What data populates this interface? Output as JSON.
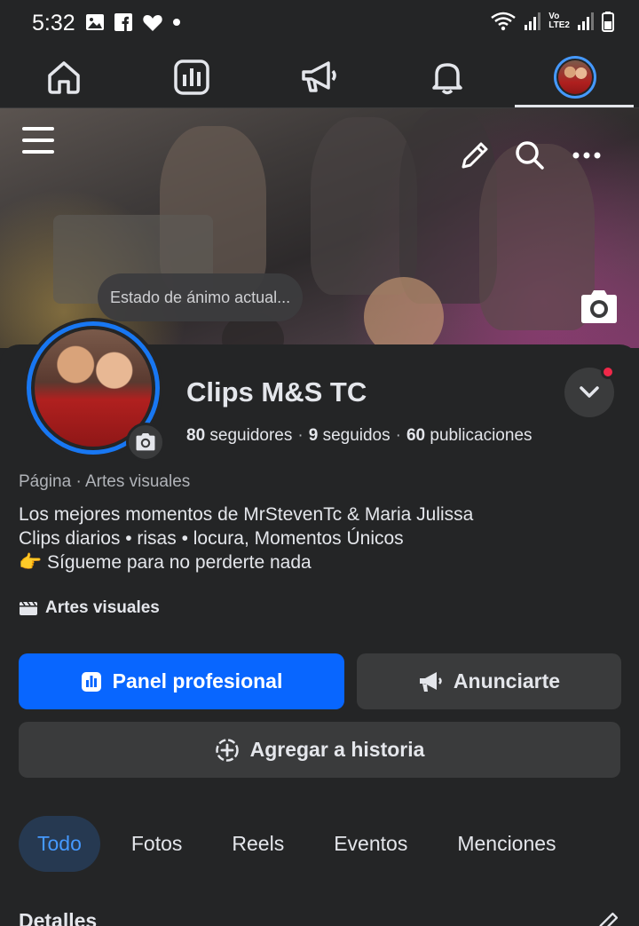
{
  "status_bar": {
    "time": "5:32",
    "left_icons": [
      "image-icon",
      "facebook-icon",
      "heart-icon",
      "dot-icon"
    ],
    "right_icons": [
      "wifi-icon",
      "signal-icon",
      "volte-icon",
      "signal-icon",
      "battery-icon"
    ],
    "volte_label_top": "Vo",
    "volte_label_bottom": "LTE2"
  },
  "top_nav": {
    "items": [
      {
        "name": "home",
        "icon": "home-icon"
      },
      {
        "name": "dashboard",
        "icon": "chart-icon"
      },
      {
        "name": "ads",
        "icon": "megaphone-icon"
      },
      {
        "name": "notifications",
        "icon": "bell-icon"
      },
      {
        "name": "profile",
        "icon": "avatar-icon"
      }
    ],
    "active": "profile"
  },
  "cover": {
    "mood_placeholder": "Estado de ánimo actual...",
    "icons": [
      "menu-icon",
      "pencil-icon",
      "search-icon",
      "more-icon",
      "camera-icon"
    ]
  },
  "profile": {
    "name": "Clips M&S TC",
    "followers_count": "80",
    "followers_label": "seguidores",
    "following_count": "9",
    "following_label": "seguidos",
    "posts_count": "60",
    "posts_label": "publicaciones",
    "separator": "·",
    "category": "Página · Artes visuales",
    "bio": [
      "Los mejores momentos de MrStevenTc & Maria Julissa",
      "Clips diarios • risas • locura, Momentos Únicos",
      "👉 Sígueme para no perderte nada"
    ],
    "tag_label": "Artes visuales"
  },
  "actions": {
    "primary_label": "Panel profesional",
    "secondary_label": "Anunciarte",
    "story_label": "Agregar a historia"
  },
  "tabs": [
    "Todo",
    "Fotos",
    "Reels",
    "Eventos",
    "Menciones"
  ],
  "active_tab": "Todo",
  "details_heading": "Detalles",
  "colors": {
    "background": "#242526",
    "primary_blue": "#0866ff",
    "active_tab_bg": "#263951",
    "active_tab_text": "#4599ff",
    "notification_dot": "#f02849"
  }
}
